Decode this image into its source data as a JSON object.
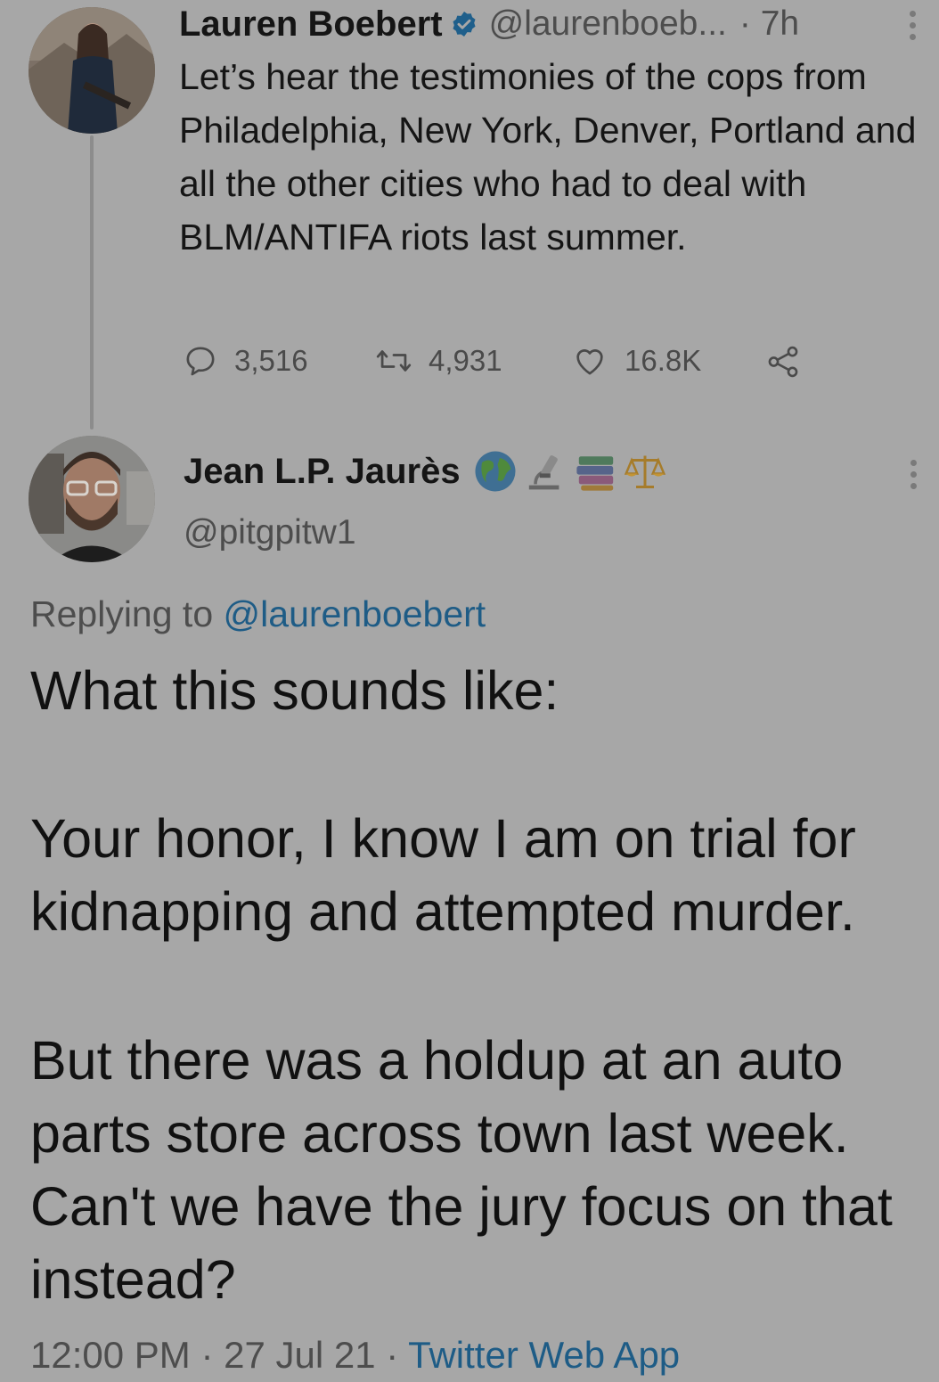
{
  "tweet1": {
    "author_name": "Lauren Boebert",
    "handle": "@laurenboeb...",
    "time": "· 7h",
    "text": "Let’s hear the testimonies of the cops from Philadelphia, New York, Denver, Portland and all the other cities who had to deal with BLM/ANTIFA riots last summer.",
    "actions": {
      "replies": "3,516",
      "retweets": "4,931",
      "likes": "16.8K"
    }
  },
  "tweet2": {
    "author_name": "Jean L.P. Jaurès",
    "handle": "@pitgpitw1",
    "replying_prefix": "Replying to",
    "replying_handle": "@laurenboebert",
    "paragraph1": "What this sounds like:",
    "paragraph2": "Your honor, I know I am on trial for kidnapping and attempted murder.",
    "paragraph3": "But there was a holdup at an auto parts store across town last week. Can't we have the jury focus on that instead?",
    "timestamp": "12:00 PM · 27 Jul 21 · ",
    "source": "Twitter Web App"
  },
  "icons": [
    "verified-badge-icon",
    "more-icon",
    "reply-icon",
    "retweet-icon",
    "like-icon",
    "share-icon",
    "globe-emoji-icon",
    "microscope-emoji-icon",
    "books-emoji-icon",
    "scales-emoji-icon"
  ],
  "colors": {
    "background": "#a7a7a7",
    "link": "#1e5c86",
    "verified": "#1f5f8b"
  }
}
